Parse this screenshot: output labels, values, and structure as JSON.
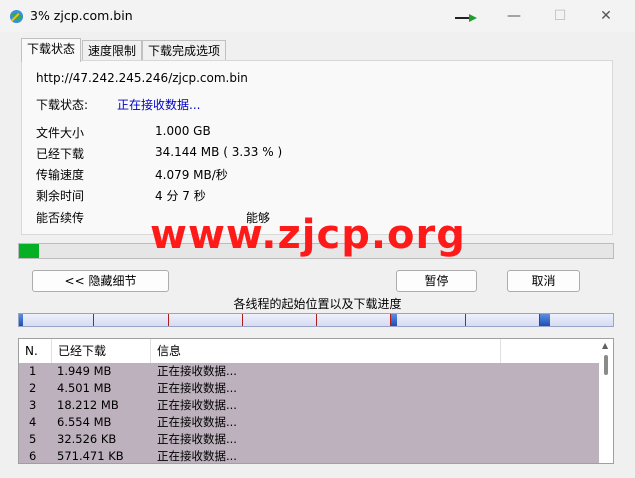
{
  "window": {
    "title": "3% zjcp.com.bin",
    "controls": {
      "minimize": "—",
      "maximize": "☐",
      "close": "✕"
    }
  },
  "tabs": [
    {
      "label": "下载状态",
      "active": true
    },
    {
      "label": "速度限制",
      "active": false
    },
    {
      "label": "下载完成选项",
      "active": false
    }
  ],
  "status": {
    "url": "http://47.242.245.246/zjcp.com.bin",
    "status_label": "下载状态:",
    "status_value": "正在接收数据...",
    "rows": [
      {
        "label": "文件大小",
        "value": "1.000  GB"
      },
      {
        "label": "已经下载",
        "value": "34.144  MB  ( 3.33 % )"
      },
      {
        "label": "传输速度",
        "value": "4.079  MB/秒"
      },
      {
        "label": "剩余时间",
        "value": "4 分 7 秒"
      },
      {
        "label": "能否续传",
        "value": "能够"
      }
    ]
  },
  "progress": {
    "percent": 3.33,
    "color": "#06b025"
  },
  "watermark": "www.zjcp.org",
  "buttons": {
    "hide_details": "<< 隐藏细节",
    "pause": "暂停",
    "cancel": "取消"
  },
  "threads": {
    "label": "各线程的起始位置以及下载进度",
    "segment_count": 8,
    "segments_progress": [
      0.02,
      0.0,
      0.0,
      0.0,
      0.0,
      0.03,
      0.0,
      0.05
    ]
  },
  "table": {
    "columns": [
      "N.",
      "已经下载",
      "信息",
      ""
    ],
    "rows": [
      {
        "n": "1",
        "downloaded": "1.949  MB",
        "info": "正在接收数据..."
      },
      {
        "n": "2",
        "downloaded": "4.501  MB",
        "info": "正在接收数据..."
      },
      {
        "n": "3",
        "downloaded": "18.212  MB",
        "info": "正在接收数据..."
      },
      {
        "n": "4",
        "downloaded": "6.554  MB",
        "info": "正在接收数据..."
      },
      {
        "n": "5",
        "downloaded": "32.526  KB",
        "info": "正在接收数据..."
      },
      {
        "n": "6",
        "downloaded": "571.471  KB",
        "info": "正在接收数据..."
      }
    ],
    "row_color": "#bcb1bc"
  }
}
